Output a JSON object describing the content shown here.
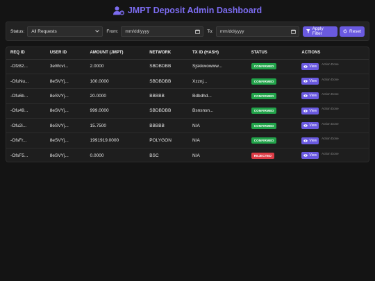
{
  "header": {
    "title": "JMPT Deposit Admin Dashboard",
    "icon": "user-gear-icon",
    "accent": "#7c6cf0"
  },
  "filters": {
    "status_label": "Status:",
    "status_value": "All Requests",
    "from_label": "From:",
    "from_placeholder": "mm/dd/yyyy",
    "to_label": "To:",
    "to_placeholder": "mm/dd/yyyy",
    "apply_label": "Apply Filter",
    "reset_label": "Reset"
  },
  "table": {
    "columns": [
      "REQ ID",
      "USER ID",
      "AMOUNT (JMPT)",
      "NETWORK",
      "TX ID (HASH)",
      "STATUS",
      "ACTIONS"
    ],
    "rows": [
      {
        "req": "-Ofz82...",
        "user": "3eWcvl...",
        "amount": "2.0000",
        "network": "SBDBDBB",
        "tx": "Sjskkwowww...",
        "status": "CONFIRMED",
        "view": "View",
        "note": "Action Done"
      },
      {
        "req": "-OfuNu...",
        "user": "8eSVYj...",
        "amount": "100.0000",
        "network": "SBDBDBB",
        "tx": "Xzznj...",
        "status": "CONFIRMED",
        "view": "View",
        "note": "Action Done"
      },
      {
        "req": "-Ofu6b...",
        "user": "8eSVYj...",
        "amount": "20.0000",
        "network": "BBBBB",
        "tx": "Bdbdhd...",
        "status": "CONFIRMED",
        "view": "View",
        "note": "Action Done"
      },
      {
        "req": "-Ofu49...",
        "user": "8eSVYj...",
        "amount": "999.0000",
        "network": "SBDBDBB",
        "tx": "Bsnsnsn...",
        "status": "CONFIRMED",
        "view": "View",
        "note": "Action Done"
      },
      {
        "req": "-Ofu2i...",
        "user": "8eSVYj...",
        "amount": "15.7500",
        "network": "BBBBB",
        "tx": "N/A",
        "status": "CONFIRMED",
        "view": "View",
        "note": "Action Done"
      },
      {
        "req": "-OfsFr...",
        "user": "8eSVYj...",
        "amount": "1991919.0000",
        "network": "POLYGON",
        "tx": "N/A",
        "status": "CONFIRMED",
        "view": "View",
        "note": "Action Done"
      },
      {
        "req": "-OfsF5...",
        "user": "8eSVYj...",
        "amount": "0.0000",
        "network": "BSC",
        "tx": "N/A",
        "status": "REJECTED",
        "view": "View",
        "note": "Action Done"
      }
    ]
  },
  "colors": {
    "confirmed": "#22a34a",
    "rejected": "#dc3c46",
    "button": "#6a5ae0"
  }
}
